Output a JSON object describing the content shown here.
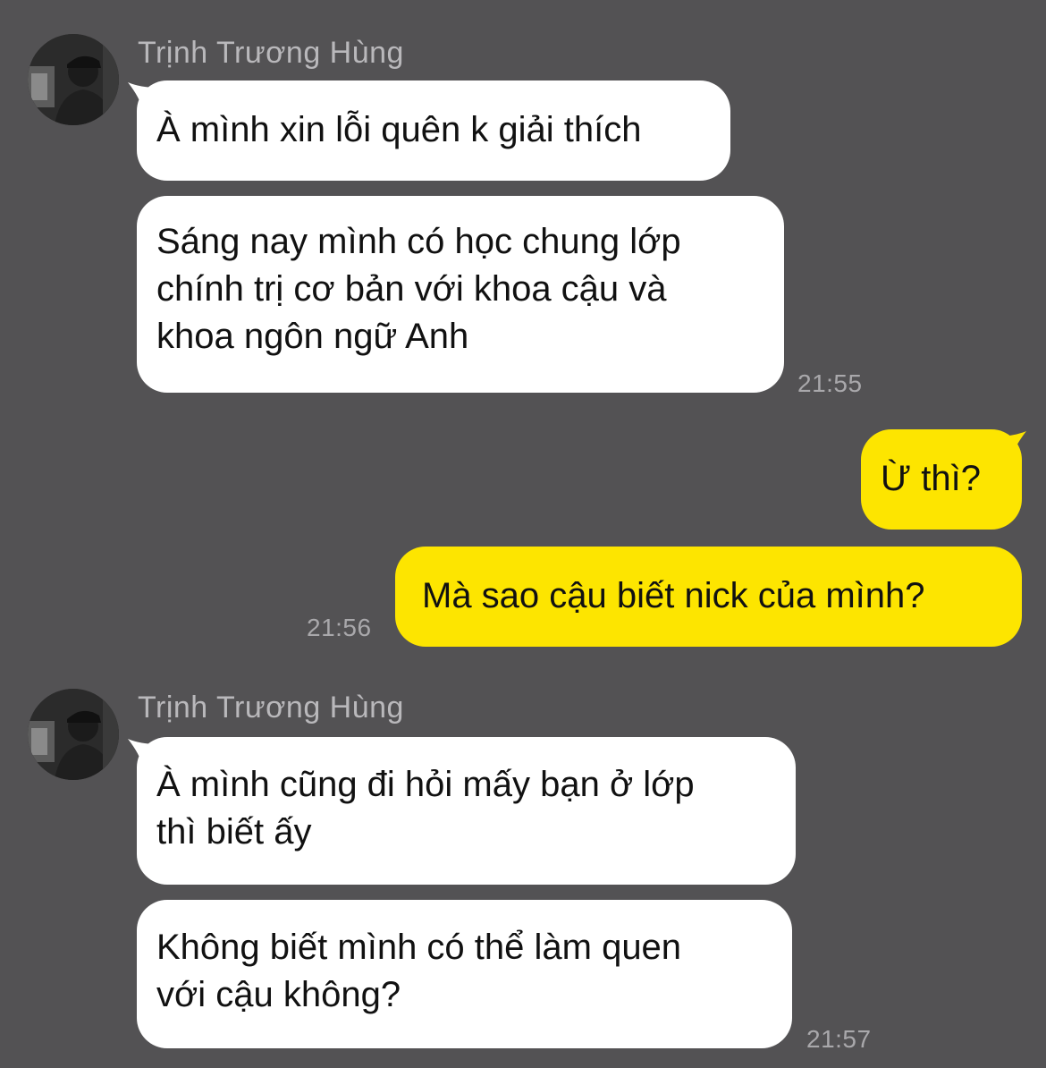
{
  "conversation": {
    "groups": [
      {
        "sender": "Trịnh Trương Hùng",
        "direction": "incoming",
        "messages": [
          "À mình xin lỗi quên k giải thích",
          "Sáng nay mình có học chung lớp\nchính trị cơ bản với khoa cậu và\nkhoa ngôn ngữ Anh"
        ],
        "time": "21:55"
      },
      {
        "direction": "outgoing",
        "messages": [
          "Ừ thì?",
          "Mà sao cậu biết nick của mình?"
        ],
        "time": "21:56"
      },
      {
        "sender": "Trịnh Trương Hùng",
        "direction": "incoming",
        "messages": [
          "À mình cũng đi hỏi mấy bạn ở lớp\nthì biết ấy",
          "Không biết mình có thể làm quen\nvới cậu không?"
        ],
        "time": "21:57"
      }
    ]
  },
  "colors": {
    "background": "#535254",
    "incoming_bubble": "#ffffff",
    "outgoing_bubble": "#fde500",
    "meta_text": "#b9b8bb"
  },
  "icons": {
    "avatar": "profile-photo-avatar-icon"
  }
}
